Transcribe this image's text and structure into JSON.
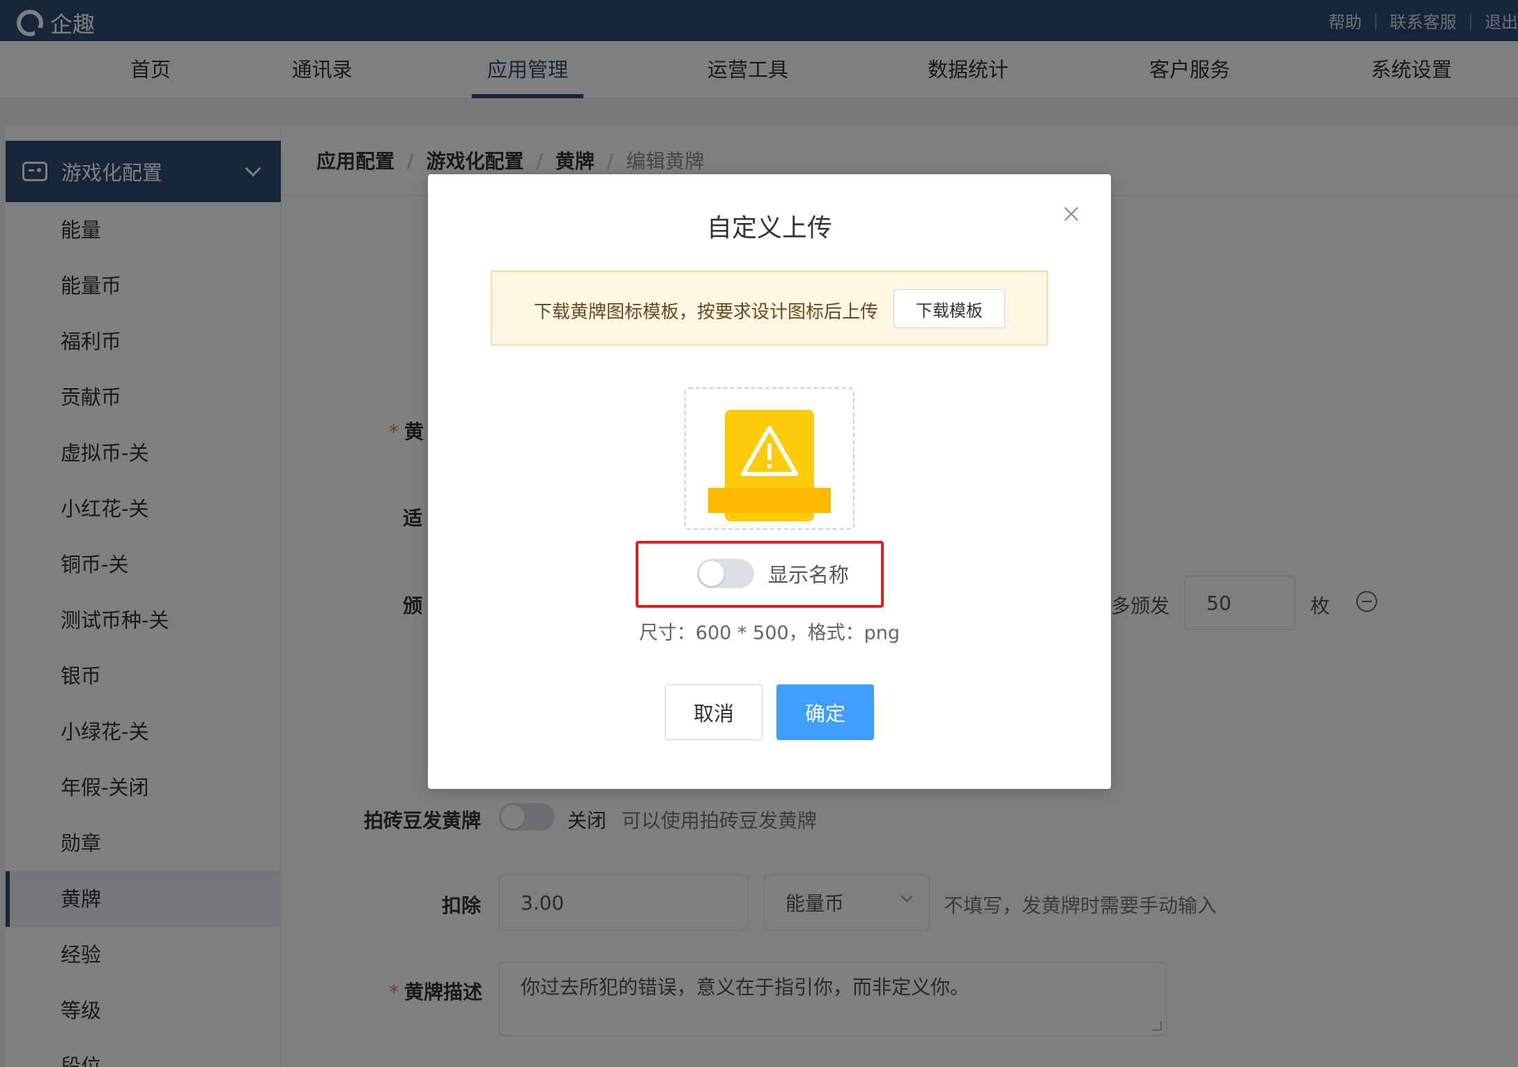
{
  "header": {
    "brand": "企趣",
    "links": [
      "帮助",
      "联系客服",
      "退出"
    ]
  },
  "nav": {
    "items": [
      "首页",
      "通讯录",
      "应用管理",
      "运营工具",
      "数据统计",
      "客户服务",
      "系统设置"
    ],
    "active": "应用管理"
  },
  "sidebar": {
    "group_title": "游戏化配置",
    "items": [
      "能量",
      "能量币",
      "福利币",
      "贡献币",
      "虚拟币-关",
      "小红花-关",
      "铜币-关",
      "测试币种-关",
      "银币",
      "小绿花-关",
      "年假-关闭",
      "勋章",
      "黄牌",
      "经验",
      "等级",
      "段位"
    ],
    "active": "黄牌"
  },
  "breadcrumb": [
    "应用配置",
    "游戏化配置",
    "黄牌",
    "编辑黄牌"
  ],
  "form": {
    "partial_labels": {
      "name": "黄",
      "applicable": "适",
      "issue": "颁"
    },
    "issue_suffix_text": "多颁发",
    "issue_max_value": "50",
    "issue_unit": "枚",
    "brick_label": "拍砖豆发黄牌",
    "brick_toggle_state": "关闭",
    "brick_hint": "可以使用拍砖豆发黄牌",
    "deduct_label": "扣除",
    "deduct_value": "3.00",
    "deduct_currency": "能量币",
    "deduct_hint": "不填写，发黄牌时需要手动输入",
    "desc_label": "黄牌描述",
    "desc_value": "你过去所犯的错误，意义在于指引你，而非定义你。"
  },
  "modal": {
    "title": "自定义上传",
    "notice_text": "下载黄牌图标模板，按要求设计图标后上传",
    "download_button": "下载模板",
    "show_name_label": "显示名称",
    "show_name_enabled": false,
    "size_hint": "尺寸：600 * 500，格式：png",
    "cancel_button": "取消",
    "confirm_button": "确定"
  },
  "colors": {
    "header_bg": "#2d4a72",
    "primary": "#409eff",
    "badge_yellow": "#fccc0a",
    "highlight_red": "#e02020"
  }
}
